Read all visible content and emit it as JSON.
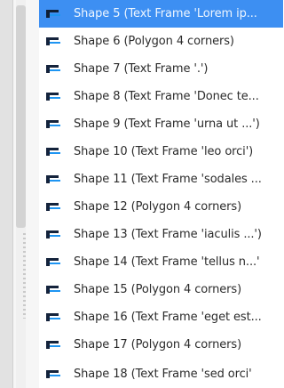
{
  "panel": {
    "rows": [
      {
        "label": "Shape 5 (Text Frame 'Lorem ip...",
        "icon": "shape-frame-icon",
        "selected": true
      },
      {
        "label": "Shape 6 (Polygon 4 corners)",
        "icon": "shape-frame-icon",
        "selected": false
      },
      {
        "label": "Shape 7 (Text Frame '.')",
        "icon": "shape-frame-icon",
        "selected": false
      },
      {
        "label": "Shape 8 (Text Frame 'Donec te...",
        "icon": "shape-frame-icon",
        "selected": false
      },
      {
        "label": "Shape 9 (Text Frame 'urna ut ...')",
        "icon": "shape-frame-icon",
        "selected": false
      },
      {
        "label": "Shape 10 (Text Frame 'leo orci')",
        "icon": "shape-frame-icon",
        "selected": false
      },
      {
        "label": "Shape 11 (Text Frame 'sodales ...",
        "icon": "shape-frame-icon",
        "selected": false
      },
      {
        "label": "Shape 12 (Polygon 4 corners)",
        "icon": "shape-frame-icon",
        "selected": false
      },
      {
        "label": "Shape 13 (Text Frame 'iaculis ...')",
        "icon": "shape-frame-icon",
        "selected": false
      },
      {
        "label": "Shape 14 (Text Frame 'tellus n...'",
        "icon": "shape-frame-icon",
        "selected": false
      },
      {
        "label": "Shape 15 (Polygon 4 corners)",
        "icon": "shape-frame-icon",
        "selected": false
      },
      {
        "label": "Shape 16 (Text Frame 'eget est...",
        "icon": "shape-frame-icon",
        "selected": false
      },
      {
        "label": "Shape 17 (Polygon 4 corners)",
        "icon": "shape-frame-icon",
        "selected": false
      },
      {
        "label": "Shape 18 (Text Frame 'sed orci'",
        "icon": "shape-frame-icon",
        "selected": false
      }
    ]
  },
  "colors": {
    "selection": "#3d8ff2",
    "icon_dark": "#14233c",
    "icon_accent": "#1e95f2"
  }
}
